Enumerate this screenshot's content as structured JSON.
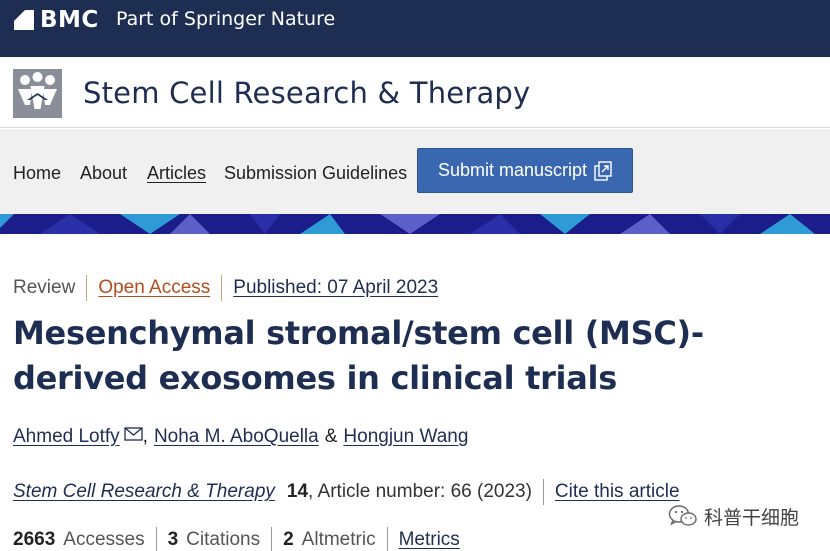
{
  "brand": {
    "name": "BMC",
    "tagline": "Part of Springer Nature",
    "bar_color": "#1e2e52"
  },
  "journal": {
    "title": "Stem Cell Research & Therapy",
    "logo_icon": "journal-people-logo"
  },
  "nav": {
    "items": [
      {
        "label": "Home"
      },
      {
        "label": "About"
      },
      {
        "label": "Articles"
      },
      {
        "label": "Submission Guidelines"
      }
    ],
    "submit_label": "Submit manuscript",
    "submit_icon": "external-submit-icon",
    "accent": "#3a68b0"
  },
  "article": {
    "type": "Review",
    "open_access": "Open Access",
    "published": "Published: 07 April 2023",
    "title": "Mesenchymal stromal/stem cell (MSC)-derived exosomes in clinical trials",
    "authors": {
      "a1": "Ahmed Lotfy",
      "comma": ",",
      "a2": "Noha M. AboQuella",
      "amp": "&",
      "a3": "Hongjun Wang"
    },
    "citation": {
      "journal": "Stem Cell Research & Therapy",
      "volume": "14",
      "rest": ", Article number: 66 (2023)",
      "cite_label": "Cite this article"
    },
    "metrics": {
      "accesses_value": "2663",
      "accesses_label": "Accesses",
      "citations_value": "3",
      "citations_label": "Citations",
      "altmetric_value": "2",
      "altmetric_label": "Altmetric",
      "metrics_link": "Metrics"
    }
  },
  "watermark": {
    "text": "科普干细胞",
    "icon": "wechat-icon"
  }
}
